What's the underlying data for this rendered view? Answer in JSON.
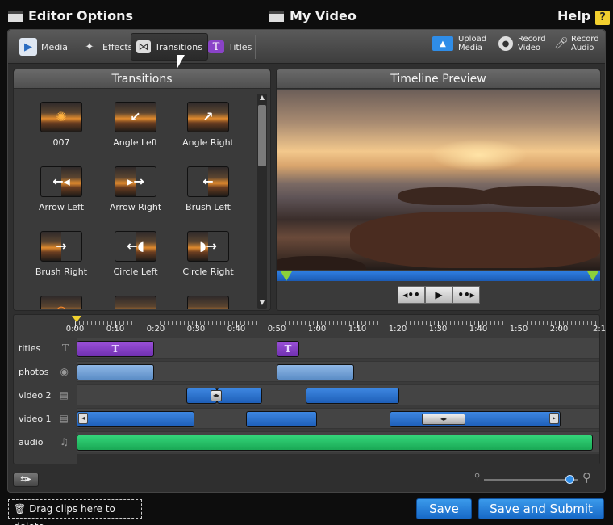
{
  "app": {
    "left_title": "Editor Options",
    "center_title": "My Video",
    "help_label": "Help",
    "help_badge": "?"
  },
  "toolbar": {
    "items": [
      {
        "label": "Media",
        "icon": "media-play-icon"
      },
      {
        "label": "Effects",
        "icon": "effects-wand-icon"
      },
      {
        "label": "Transitions",
        "icon": "transitions-icon",
        "active": true
      },
      {
        "label": "Titles",
        "icon": "titles-t-icon"
      }
    ],
    "right_items": [
      {
        "line1": "Upload",
        "line2": "Media",
        "icon": "upload-monitor-icon"
      },
      {
        "line1": "Record",
        "line2": "Video",
        "icon": "webcam-icon"
      },
      {
        "line1": "Record",
        "line2": "Audio",
        "icon": "microphone-icon"
      }
    ]
  },
  "transitions_panel": {
    "title": "Transitions",
    "tiles": [
      {
        "label": "007"
      },
      {
        "label": "Angle Left"
      },
      {
        "label": "Angle Right"
      },
      {
        "label": "Arrow Left"
      },
      {
        "label": "Arrow Right"
      },
      {
        "label": "Brush Left"
      },
      {
        "label": "Brush Right"
      },
      {
        "label": "Circle Left"
      },
      {
        "label": "Circle Right"
      }
    ]
  },
  "preview_panel": {
    "title": "Timeline Preview",
    "controls": [
      "◂••",
      "▶",
      "••▸"
    ]
  },
  "timeline": {
    "time_labels": [
      "0:00",
      "0:10",
      "0:20",
      "0:30",
      "0:40",
      "0:50",
      "1:00",
      "1:10",
      "1:20",
      "1:30",
      "1:40",
      "1:50",
      "2:00",
      "2:1"
    ],
    "tracks": [
      {
        "label": "titles",
        "icon": "T"
      },
      {
        "label": "photos",
        "icon": "◉"
      },
      {
        "label": "video 2",
        "icon": "▤"
      },
      {
        "label": "video 1",
        "icon": "▤"
      },
      {
        "label": "audio",
        "icon": "♫"
      }
    ],
    "title_clip_glyph": "T",
    "transition_glyph": "◂▸",
    "handle_left": "◂",
    "handle_right": "▸",
    "zoom_level": 0.92
  },
  "footer": {
    "drag_label": "Drag clips here to delete",
    "save_label": "Save",
    "save_submit_label": "Save and Submit"
  },
  "colors": {
    "accent_blue": "#1e6fd0",
    "title_purple": "#8a43c8",
    "audio_green": "#22c064",
    "playhead_yellow": "#f2d22e"
  }
}
